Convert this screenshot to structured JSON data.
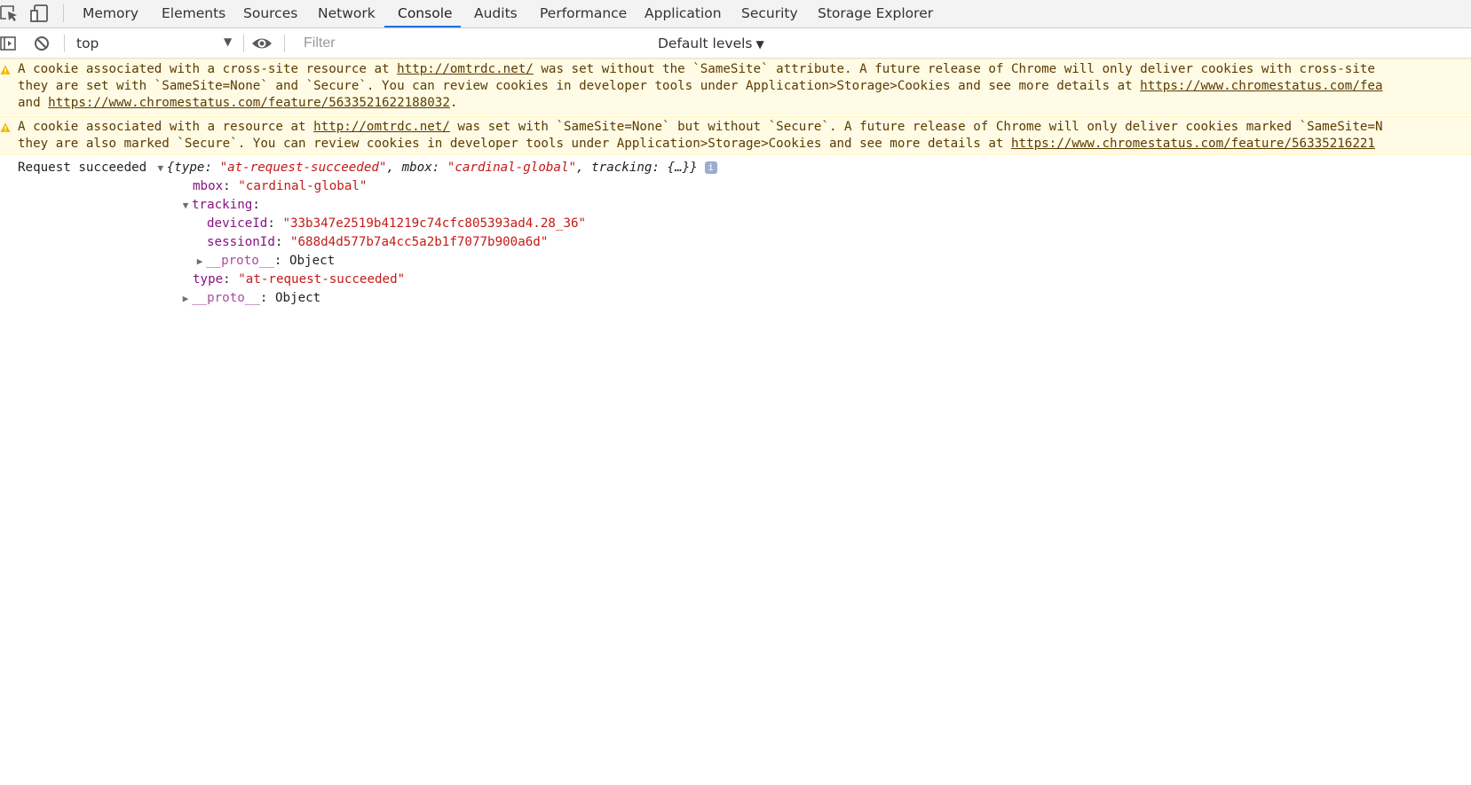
{
  "tabs": [
    {
      "label": "Memory",
      "active": false
    },
    {
      "label": "Elements",
      "active": false
    },
    {
      "label": "Sources",
      "active": false
    },
    {
      "label": "Network",
      "active": false
    },
    {
      "label": "Console",
      "active": true
    },
    {
      "label": "Audits",
      "active": false
    },
    {
      "label": "Performance",
      "active": false
    },
    {
      "label": "Application",
      "active": false
    },
    {
      "label": "Security",
      "active": false
    },
    {
      "label": "Storage Explorer",
      "active": false
    }
  ],
  "toolbar": {
    "context": "top",
    "filter_placeholder": "Filter",
    "levels": "Default levels",
    "levels_arrow": "▼"
  },
  "messages": {
    "warning1": {
      "line1_a": "A cookie associated with a cross-site resource at ",
      "line1_link": "http://omtrdc.net/",
      "line1_b": " was set without the `SameSite` attribute. A future release of Chrome will only deliver cookies with cross-site",
      "line2_a": "they are set with `SameSite=None` and `Secure`. You can review cookies in developer tools under Application>Storage>Cookies and see more details at ",
      "line2_link": "https://www.chromestatus.com/fea",
      "line3_a": "and ",
      "line3_link": "https://www.chromestatus.com/feature/5633521622188032",
      "line3_b": "."
    },
    "warning2": {
      "line1_a": "A cookie associated with a resource at ",
      "line1_link": "http://omtrdc.net/",
      "line1_b": " was set with `SameSite=None` but without `Secure`. A future release of Chrome will only deliver cookies marked `SameSite=N",
      "line2_a": "they are also marked `Secure`. You can review cookies in developer tools under Application>Storage>Cookies and see more details at ",
      "line2_link": "https://www.chromestatus.com/feature/56335216221"
    },
    "log": {
      "label": "Request succeeded",
      "summary_open": "{type: ",
      "summary_type": "\"at-request-succeeded\"",
      "summary_mid": ", mbox: ",
      "summary_mbox": "\"cardinal-global\"",
      "summary_end": ", tracking: {…}}",
      "info": "i",
      "mbox_key": "mbox",
      "mbox_val": "\"cardinal-global\"",
      "tracking_key": "tracking",
      "deviceId_key": "deviceId",
      "deviceId_val": "\"33b347e2519b41219c74cfc805393ad4.28_36\"",
      "sessionId_key": "sessionId",
      "sessionId_val": "\"688d4d577b7a4cc5a2b1f7077b900a6d\"",
      "proto_key": "__proto__",
      "proto_val": "Object",
      "type_key": "type",
      "type_val": "\"at-request-succeeded\""
    }
  }
}
